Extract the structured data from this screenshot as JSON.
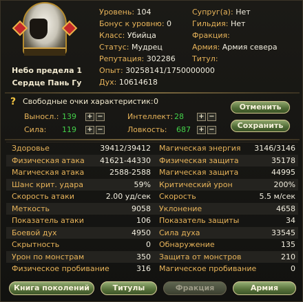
{
  "character": {
    "title_line1": "Небо предела 1",
    "title_line2": "Сердце Пань Гу"
  },
  "info_left": [
    {
      "key": "Уровень:",
      "value": "104"
    },
    {
      "key": "Бонус к уровню:",
      "value": "0"
    },
    {
      "key": "Класс:",
      "value": "Убийца"
    },
    {
      "key": "Статус:",
      "value": "Мудрец"
    },
    {
      "key": "Репутация:",
      "value": "302286"
    },
    {
      "key": "Опыт:",
      "value": "30258141/1750000000"
    },
    {
      "key": "Дух:",
      "value": "10614618"
    }
  ],
  "info_right": [
    {
      "key": "Супруг(а):",
      "value": "Нет"
    },
    {
      "key": "Гильдия:",
      "value": "Нет"
    },
    {
      "key": "Фракция:",
      "value": ""
    },
    {
      "key": "Армия:",
      "value": "Армия севера"
    },
    {
      "key": "Титул:",
      "value": ""
    }
  ],
  "free_points": {
    "title": "Свободные очки характеристик:",
    "count": "0",
    "stamina_label": "Выносл.:",
    "stamina_value": "139",
    "strength_label": "Сила:",
    "strength_value": "119",
    "intellect_label": "Интеллект:",
    "intellect_value": "28",
    "agility_label": "Ловкость:",
    "agility_value": "687",
    "plus": "+",
    "minus": "−",
    "cancel_label": "Отменить",
    "save_label": "Сохранить"
  },
  "stats": [
    {
      "l": "Здоровье",
      "v1": "39412/39412",
      "r": "Магическая энергия",
      "v2": "3146/3146"
    },
    {
      "l": "Физическая атака",
      "v1": "41621-44330",
      "r": "Физическая защита",
      "v2": "35178"
    },
    {
      "l": "Магическая атака",
      "v1": "2588-2588",
      "r": "Магическая защита",
      "v2": "44995"
    },
    {
      "l": "Шанс крит. удара",
      "v1": "59%",
      "r": "Критический урон",
      "v2": "200%"
    },
    {
      "l": "Скорость атаки",
      "v1": "2.00 уд/сек",
      "r": "Скорость",
      "v2": "5.5 м/сек"
    },
    {
      "l": "Меткость",
      "v1": "9058",
      "r": "Уклонение",
      "v2": "4658"
    },
    {
      "l": "Показатель атаки",
      "v1": "106",
      "r": "Показатель защиты",
      "v2": "34"
    },
    {
      "l": "Боевой дух",
      "v1": "4950",
      "r": "Сила духа",
      "v2": "33545"
    },
    {
      "l": "Скрытность",
      "v1": "0",
      "r": "Обнаружение",
      "v2": "135"
    },
    {
      "l": "Урон по монстрам",
      "v1": "350",
      "r": "Защита от монстров",
      "v2": "210"
    },
    {
      "l": "Физическое пробивание",
      "v1": "316",
      "r": "Магическое пробивание",
      "v2": "0"
    }
  ],
  "tabs": {
    "generations": "Книга поколений",
    "titles": "Титулы",
    "faction": "Фракция",
    "army": "Армия"
  },
  "icons": {
    "help": "question-icon"
  }
}
